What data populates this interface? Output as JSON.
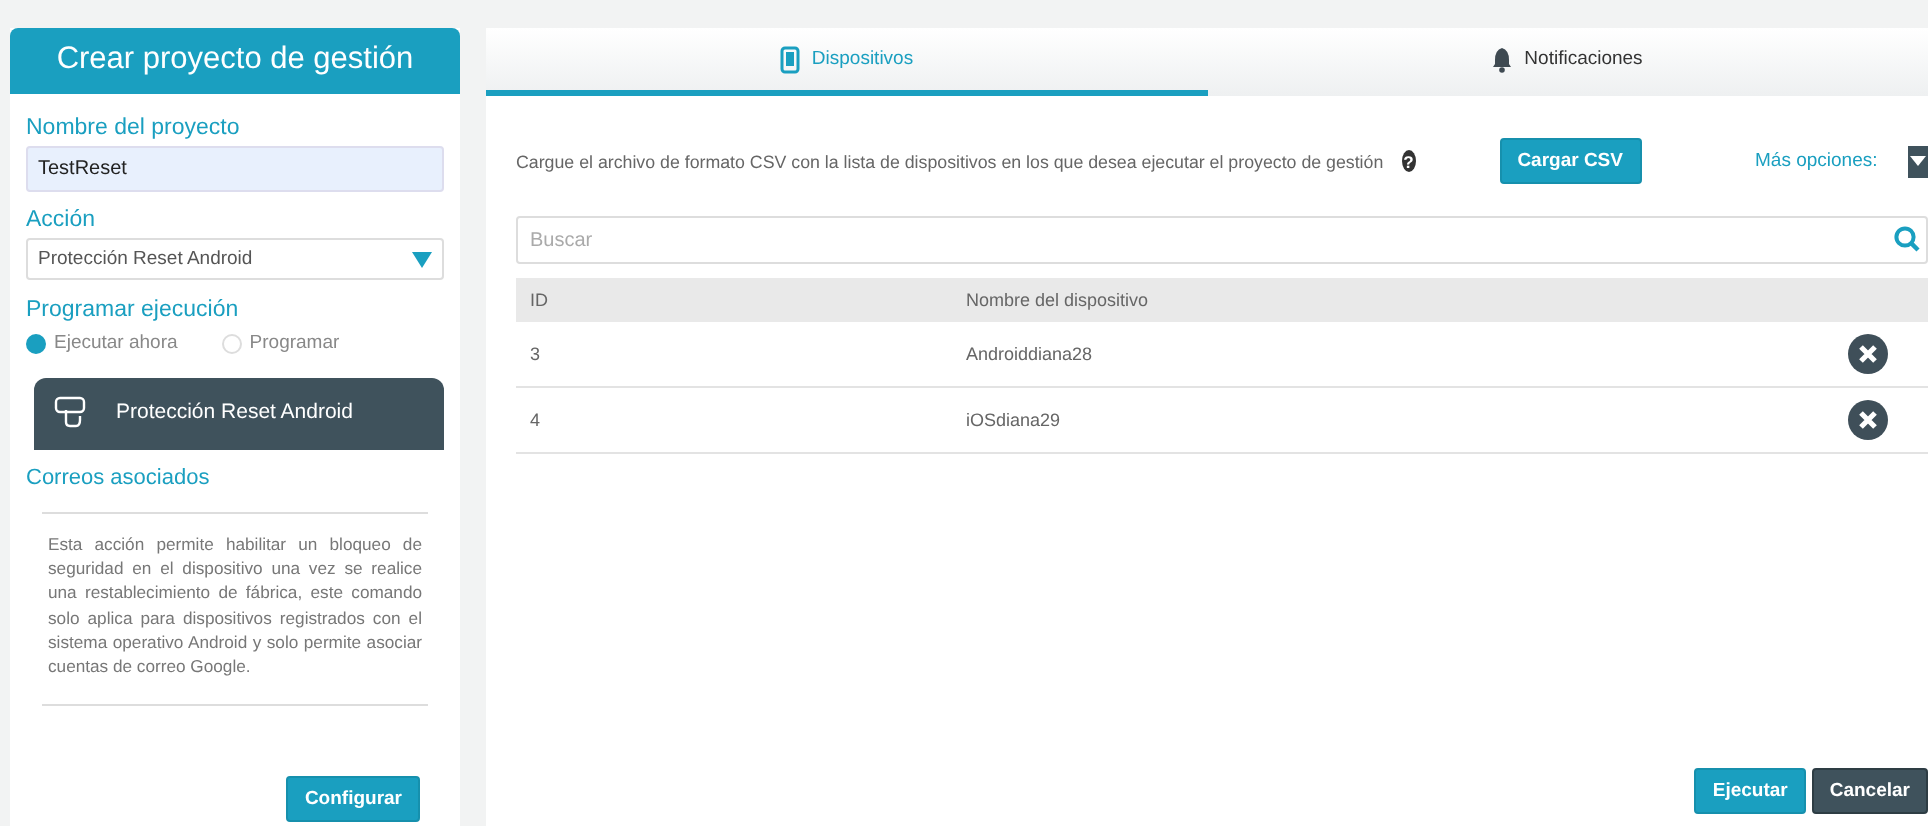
{
  "left_panel": {
    "title": "Crear proyecto de gestión",
    "project_name": {
      "label": "Nombre del proyecto",
      "value": "TestReset"
    },
    "action": {
      "label": "Acción",
      "value": "Protección Reset Android"
    },
    "schedule": {
      "label": "Programar ejecución",
      "options": [
        {
          "label": "Ejecutar ahora",
          "selected": true
        },
        {
          "label": "Programar",
          "selected": false
        }
      ]
    },
    "action_card": {
      "title": "Protección Reset Android"
    },
    "emails_label": "Correos asociados",
    "description": "Esta acción permite habilitar un bloqueo de seguridad en el dispositivo una vez se realice una restablecimiento de fábrica, este comando solo aplica para dispositivos registrados con el sistema operativo Android y solo permite asociar cuentas de correo Google.",
    "configure_button": "Configurar"
  },
  "tabs": [
    {
      "label": "Dispositivos",
      "selected": true
    },
    {
      "label": "Notificaciones",
      "selected": false
    }
  ],
  "upload": {
    "instructions": "Cargue el archivo de formato CSV con la lista de dispositivos en los que desea ejecutar el proyecto de gestión",
    "help": "?",
    "button": "Cargar CSV",
    "more_options": "Más opciones:"
  },
  "search": {
    "placeholder": "Buscar"
  },
  "table": {
    "columns": [
      "ID",
      "Nombre del dispositivo"
    ],
    "rows": [
      {
        "id": "3",
        "name": "Androiddiana28"
      },
      {
        "id": "4",
        "name": "iOSdiana29"
      }
    ]
  },
  "buttons": [
    {
      "label": "Ejecutar",
      "kind": "primary"
    },
    {
      "label": "Cancelar",
      "kind": "secondary"
    }
  ]
}
